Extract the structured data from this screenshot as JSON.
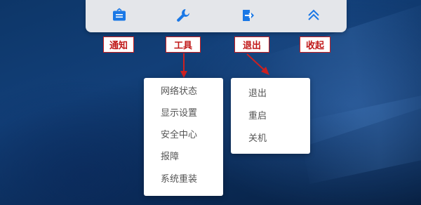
{
  "toolbar": {
    "buttons": [
      {
        "icon": "notification-board-icon",
        "label": "通知"
      },
      {
        "icon": "wrench-icon",
        "label": "工具"
      },
      {
        "icon": "exit-door-icon",
        "label": "退出"
      },
      {
        "icon": "chevron-up-icon",
        "label": "收起"
      }
    ],
    "accent_color": "#1a78e6"
  },
  "tools_menu": {
    "items": [
      "网络状态",
      "显示设置",
      "安全中心",
      "报障",
      "系统重装"
    ]
  },
  "exit_menu": {
    "items": [
      "退出",
      "重启",
      "关机"
    ]
  },
  "annotation_color": "#cc2020"
}
